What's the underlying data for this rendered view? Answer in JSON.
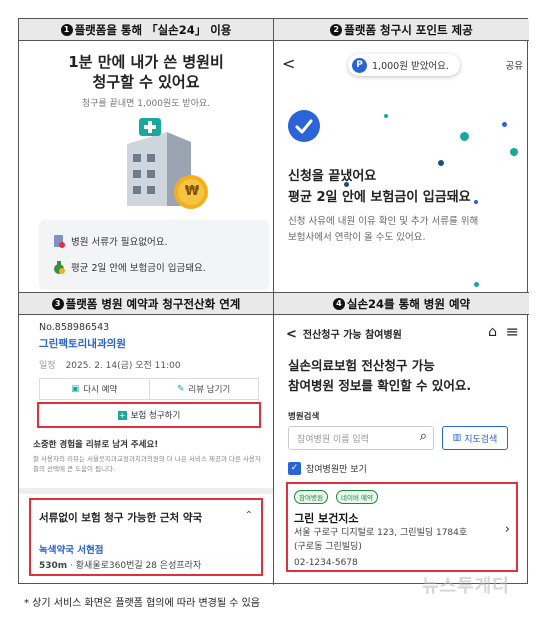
{
  "headers": {
    "p1": {
      "num": "1",
      "text": "플랫폼을 통해 「실손24」 이용"
    },
    "p2": {
      "num": "2",
      "text": "플랫폼 청구시 포인트 제공"
    },
    "p3": {
      "num": "3",
      "text": "플랫폼 병원 예약과 청구전산화 연계"
    },
    "p4": {
      "num": "4",
      "text": "실손24를 통해 병원 예약"
    }
  },
  "panel1": {
    "title_line1": "1분 만에 내가 쓴 병원비",
    "title_line2": "청구할 수 있어요",
    "subtitle": "청구를 끝내면 1,000원도 받아요.",
    "coin_symbol": "₩",
    "items": [
      {
        "icon": "document-cancel-icon",
        "text": "병원 서류가 필요없어요."
      },
      {
        "icon": "money-bag-icon",
        "text": "평균 2일 안에 보험금이 입금돼요."
      }
    ]
  },
  "panel2": {
    "back": "<",
    "pill_badge": "P",
    "pill_text": "1,000원 받았어요.",
    "share": "공유",
    "heading_line1": "신청을 끝냈어요",
    "heading_line2": "평균 2일 안에 보험금이 입금돼요",
    "desc_line1": "신청 사유에 내원 이유 확인 및 추가 서류를 위해",
    "desc_line2": "보험사에서 연락이 올 수도 있어요."
  },
  "panel3": {
    "order_no": "No.858986543",
    "clinic": "그린팩토리내과의원",
    "date_label": "일정",
    "date_value": "2025. 2. 14(금) 오전 11:00",
    "rebook": "다시 예약",
    "review": "리뷰 남기기",
    "claim": "보험 청구하기",
    "review_title": "소중한 경험을 리뷰로 남겨 주세요!",
    "review_desc": "잘 사용자의 리뷰는 서울읏지과교정과치과의원의 더 나은 서비스 제공과 다른 사용자들의 선택에 큰 도움이 됩니다.",
    "pharmacy_title": "서류없이 보험 청구 가능한 근처 약국",
    "pharmacy_name": "녹색약국 서현점",
    "pharmacy_dist": "530m",
    "pharmacy_addr": "황새울로360번길 28 은성프라자"
  },
  "panel4": {
    "top_title": "전산청구 가능 참여병원",
    "heading_line1": "실손의료보험 전산청구 가능",
    "heading_line2": "참여병원 정보를 확인할 수 있어요.",
    "search_label": "병원검색",
    "search_placeholder": "참여병원 이름 입력",
    "map_button": "지도검색",
    "checkbox_label": "참여병원만 보기",
    "tag1": "참여병원",
    "tag2": "네이버 예약",
    "hospital_name": "그린 보건지소",
    "address_line1": "서울 구로구 디지털로 123, 그린빌딩 1784호",
    "address_line2": "(구로동 그린빌딩)",
    "phone": "02-1234-5678"
  },
  "footnote": "* 상기 서비스 화면은 플랫폼 협의에 따라 변경될 수 있음",
  "watermark": "뉴스투게더",
  "colors": {
    "accent_blue": "#2a63d6",
    "highlight_red": "#e0303b",
    "teal": "#1ba89c",
    "header_bg": "#e9e9e9"
  }
}
